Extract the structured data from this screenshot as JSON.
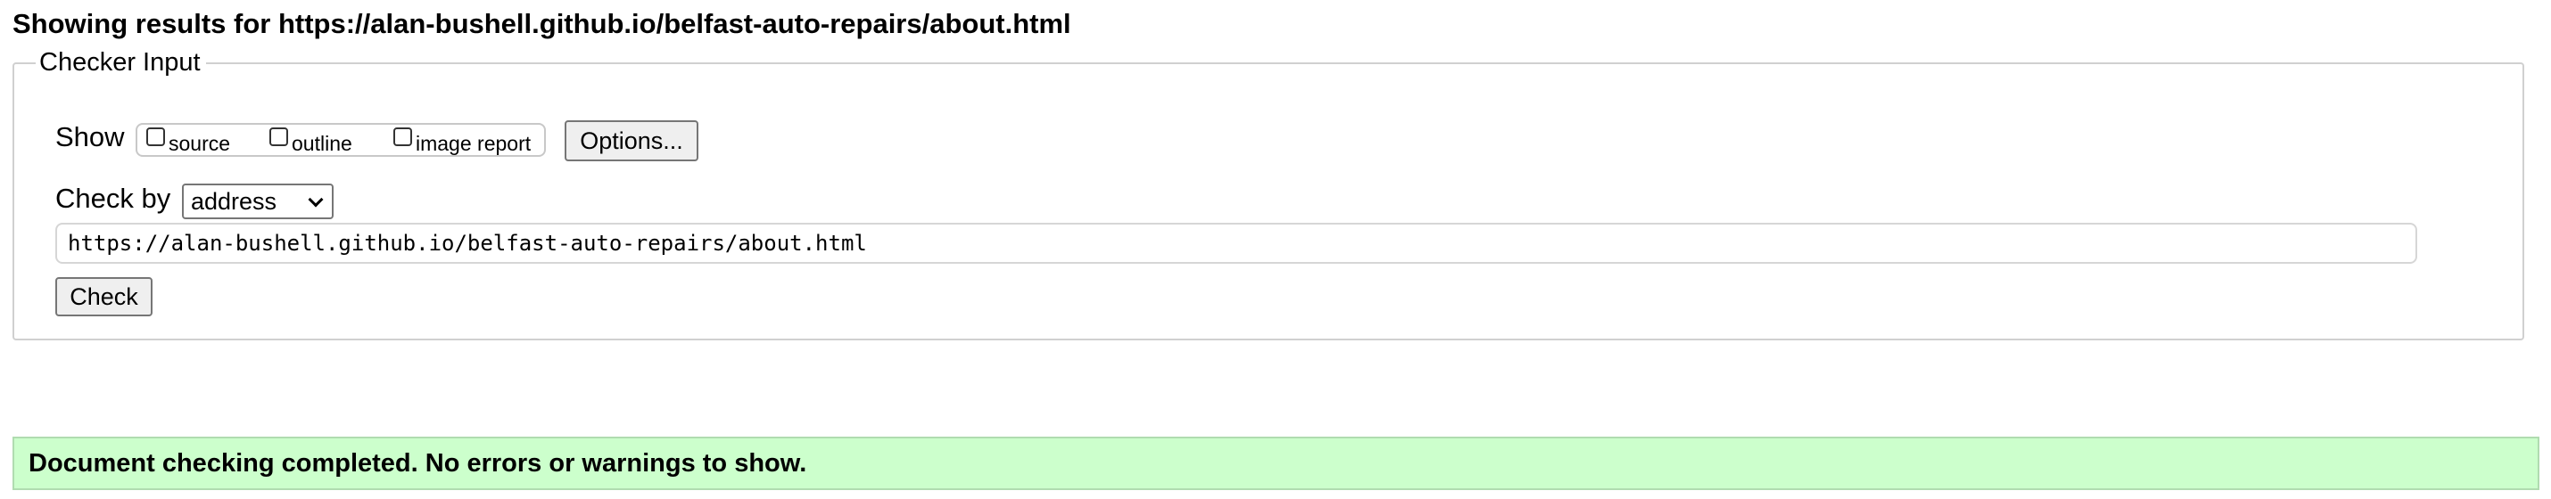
{
  "heading": "Showing results for https://alan-bushell.github.io/belfast-auto-repairs/about.html",
  "checker": {
    "legend": "Checker Input",
    "show_label": "Show",
    "show_options": [
      {
        "label": "source",
        "checked": false
      },
      {
        "label": "outline",
        "checked": false
      },
      {
        "label": "image report",
        "checked": false
      }
    ],
    "options_button": "Options...",
    "check_by_label": "Check by",
    "check_by_selected": "address",
    "url_value": "https://alan-bushell.github.io/belfast-auto-repairs/about.html",
    "check_button": "Check"
  },
  "status": {
    "message": "Document checking completed. No errors or warnings to show.",
    "background_color": "#ccffcc"
  }
}
